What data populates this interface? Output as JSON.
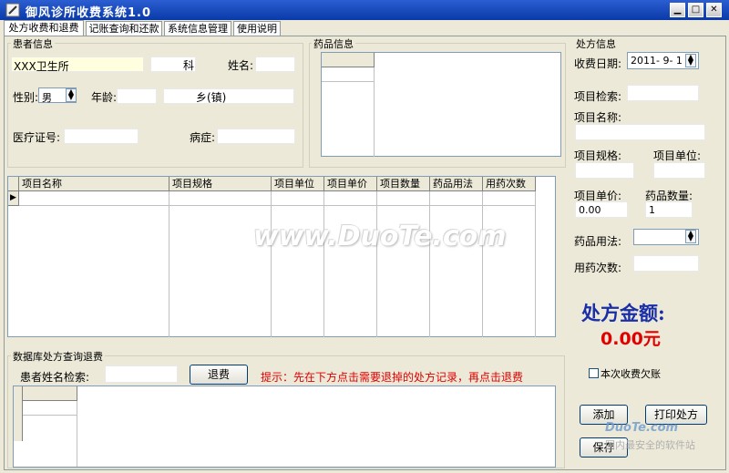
{
  "window": {
    "title": "御风诊所收费系统1.0"
  },
  "tabs": [
    "处方收费和退费",
    "记账查询和还款",
    "系统信息管理",
    "使用说明"
  ],
  "patient": {
    "group_title": "患者信息",
    "clinic_name": "XXX卫生所",
    "dept_label": "科",
    "name_label": "姓名:",
    "gender_label": "性别:",
    "gender_value": "男",
    "age_label": "年龄:",
    "township_label": "乡(镇)",
    "insurance_label": "医疗证号:",
    "disease_label": "病症:"
  },
  "drugs": {
    "group_title": "药品信息"
  },
  "items_table": {
    "columns": [
      "项目名称",
      "项目规格",
      "项目单位",
      "项目单价",
      "项目数量",
      "药品用法",
      "用药次数"
    ]
  },
  "refund": {
    "group_title": "数据库处方查询退费",
    "search_label": "患者姓名检索:",
    "refund_button": "退费",
    "hint": "提示：先在下方点击需要退掉的处方记录，再点击退费"
  },
  "prescription": {
    "group_title": "处方信息",
    "date_label": "收费日期:",
    "date_value": "2011- 9- 1",
    "item_search_label": "项目检索:",
    "item_name_label": "项目名称:",
    "item_spec_label": "项目规格:",
    "item_unit_label": "项目单位:",
    "unit_price_label": "项目单价:",
    "unit_price_value": "0.00",
    "quantity_label": "药品数量:",
    "quantity_value": "1",
    "usage_label": "药品用法:",
    "times_label": "用药次数:",
    "total_label": "处方金额:",
    "total_value": "0.00元",
    "credit_checkbox_label": "本次收费欠账",
    "add_button": "添加",
    "print_button": "打印处方",
    "save_button": "保存"
  },
  "watermarks": {
    "center": "www.DuoTe.com",
    "corner_line1": "DuoTe.com",
    "corner_line2": "国内最安全的软件站"
  },
  "colors": {
    "title_bar": "#0a3aa8",
    "total_label": "#1a2ea8",
    "total_value": "#e00000",
    "hint": "#e00000"
  }
}
